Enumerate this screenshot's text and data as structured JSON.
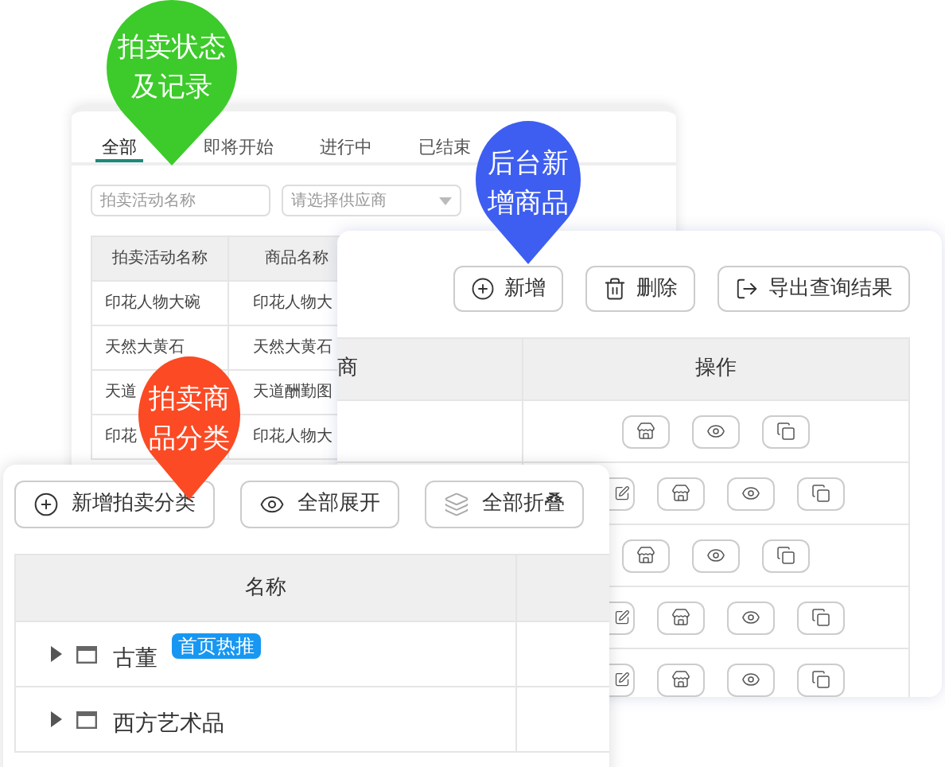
{
  "auction_list": {
    "tabs": [
      {
        "label": "全部",
        "selected": true
      },
      {
        "label": "即将开始",
        "selected": false
      },
      {
        "label": "进行中",
        "selected": false
      },
      {
        "label": "已结束",
        "selected": false
      }
    ],
    "search": {
      "placeholder": "拍卖活动名称"
    },
    "supplier_select": {
      "placeholder": "请选择供应商"
    },
    "table": {
      "columns": [
        "拍卖活动名称",
        "商品名称"
      ],
      "rows": [
        [
          "印花人物大碗",
          "印花人物大"
        ],
        [
          "天然大黄石",
          "天然大黄石"
        ],
        [
          "天道",
          "天道酬勤图"
        ],
        [
          "印花",
          "印花人物大"
        ]
      ]
    }
  },
  "product_admin": {
    "buttons": [
      "新增",
      "删除",
      "导出查询结果"
    ],
    "table": {
      "columns": [
        "商",
        "操作"
      ],
      "rows": [
        {
          "kind": "view_only"
        },
        {
          "kind": "editable"
        },
        {
          "kind": "view_only"
        },
        {
          "kind": "editable"
        },
        {
          "kind": "editable"
        }
      ]
    }
  },
  "category_panel": {
    "buttons": [
      "新增拍卖分类",
      "全部展开",
      "全部折叠"
    ],
    "table": {
      "columns": [
        "名称"
      ],
      "rows": [
        {
          "name": "古董",
          "badge": "首页热推"
        },
        {
          "name": "西方艺术品"
        }
      ]
    }
  },
  "pins": [
    {
      "label": "拍卖状态及记录",
      "color": "#3ccb2a"
    },
    {
      "label": "后台新增商品",
      "color": "#3d5ef0"
    },
    {
      "label": "拍卖商品分类",
      "color": "#fb4a24"
    }
  ]
}
